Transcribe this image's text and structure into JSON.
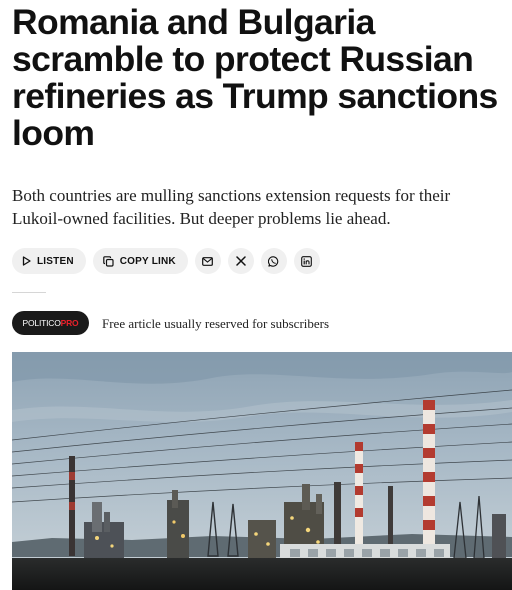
{
  "article": {
    "headline": "Romania and Bulgaria scramble to protect Russian refineries as Trump sanctions loom",
    "dek": "Both countries are mulling sanctions extension requests for their Lukoil-owned facilities. But deeper problems lie ahead."
  },
  "share": {
    "listen_label": "LISTEN",
    "copy_link_label": "COPY LINK",
    "icons": [
      "play-icon",
      "copy-icon",
      "mail-icon",
      "x-icon",
      "whatsapp-icon",
      "linkedin-icon"
    ]
  },
  "subscription": {
    "badge_brand": "POLITICO",
    "badge_suffix": "PRO",
    "note": "Free article usually reserved for subscribers"
  },
  "colors": {
    "badge_bg": "#1a1a1a",
    "badge_accent": "#e8202a",
    "pill_bg": "#f0f0f0",
    "sky": "#9fb3c3"
  }
}
